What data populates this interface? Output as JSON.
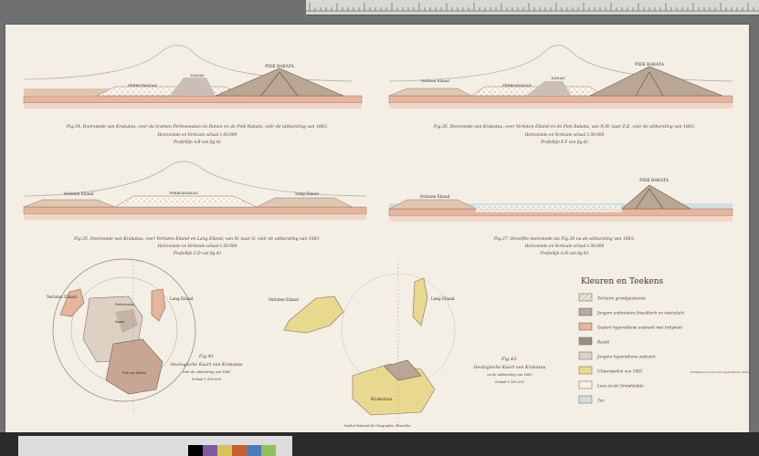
{
  "sheet": {
    "publisher": "Institut National de Géographie, Bruxelles"
  },
  "figures": {
    "f34": {
      "caption": "Fig.34. Doorsnede van Krakatau, over da kramen Perboewatan en Danan en de Piek Rakata, vóór de uitbarsting van 1883.",
      "scale": "Horizontale en Verticale schaal 1:50.000",
      "profile": "Profiellijn A.B van fig.42",
      "peak": "PIEK RAKATA",
      "crater1": "PERBOEWATAN",
      "crater2": "DANAN"
    },
    "f36": {
      "caption": "Fig.36. Doorsnede van Krakatau, over Verlaten Eiland en de Piek Rakata, van N.W. naar Z.E. vóór de uitbarsting van 1883.",
      "scale": "Horizontale en Verticale schaal 1:50.000",
      "profile": "Profiellijn E.F van fig.42",
      "peak": "PIEK RAKATA",
      "island": "Verlaten Eiland",
      "crater1": "PERBOEWATAN",
      "crater2": "DANAN"
    },
    "f35": {
      "caption": "Fig.35. Doorsnede van Krakatau, over Verlaten Eiland en Lang Eiland, van W. naar O. vóór de uitbarsting van 1883.",
      "scale": "Horizontale en Verticale schaal 1:50.000",
      "profile": "Profiellijn C.D van fig.42",
      "island1": "Verlaten Eiland",
      "island2": "Lang Eiland",
      "crater": "PERBOEWATAN"
    },
    "f37": {
      "caption": "Fig.37. Dezelfde doorsnede als Fig.36 na de uitbarsting van 1883.",
      "scale": "Horizontale en Verticale schaal 1:50.000",
      "profile": "Profiellijn G.H van fig.43",
      "peak": "PIEK RAKATA",
      "island": "Verlaten Eiland"
    },
    "f42": {
      "title": "Fig.42",
      "subtitle": "Geologische Kaart van Krakatau",
      "note": "vóór de uitbarsting van 1883",
      "scale": "Schaal 1:100.000",
      "island1": "Verlaten Eiland",
      "island2": "Lang Eiland",
      "label1": "Perboewatan",
      "label2": "Danan",
      "label3": "Piek van Rakata"
    },
    "f43": {
      "title": "Fig.43.",
      "subtitle": "Geologische Kaart van Krakatau",
      "note": "na de uitbarsting van 1883",
      "scale": "Schaal 1:100.000",
      "island1": "Verlaten Eiland",
      "island2": "Lang Eiland",
      "island3": "Krakatau"
    }
  },
  "legend": {
    "title": "Kleuren en Teekens",
    "items": [
      {
        "label": "Tertiaire grondgesteente",
        "color": "#e9e2d0"
      },
      {
        "label": "Jongere andesieten (basaltisch en vesiculair)",
        "color": "#b7a9a0"
      },
      {
        "label": "Oudere hypersthene andesiet met tridymiet",
        "color": "#e6b59c"
      },
      {
        "label": "Basalt",
        "color": "#9c8f80"
      },
      {
        "label": "Jongere hypersthene andesiet",
        "color": "#ddd1c4"
      },
      {
        "label": "Uitwerpselen van 1883",
        "color": "#e8d98f"
      },
      {
        "label": "Lava en de Grondvlakte",
        "color": "#f5f1e8"
      },
      {
        "label": "Zee",
        "color": "#cfdfe0"
      }
    ],
    "bracket_note": "Puimsteen en asch van hypersthene andesiet"
  },
  "colors": {
    "paper": "#f3efe4",
    "ink": "#4a3f36",
    "salmon": "#e6b59c",
    "yellow": "#e8d98f",
    "sea": "#cfdfe0"
  }
}
